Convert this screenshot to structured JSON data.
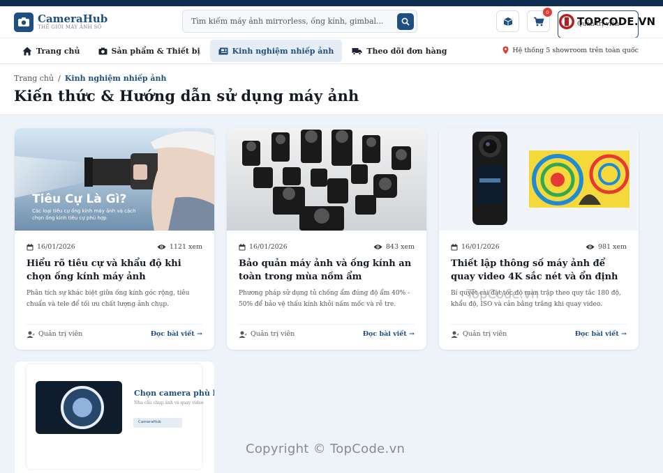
{
  "brand": {
    "name": "CameraHub",
    "tagline": "THẾ GIỚI MÁY ẢNH SỐ"
  },
  "search": {
    "placeholder": "Tìm kiếm máy ảnh mirrorless, ống kính, gimbal..."
  },
  "cart": {
    "count": "0"
  },
  "account": {
    "label": "Quản trị viên"
  },
  "watermark": {
    "logo_text": "TOPCODE.VN",
    "mid_text": "TopCode.vn",
    "copyright": "Copyright © TopCode.vn"
  },
  "nav": {
    "items": [
      {
        "label": "Trang chủ",
        "icon": "home-icon",
        "active": false
      },
      {
        "label": "Sản phẩm & Thiết bị",
        "icon": "camera-icon",
        "active": false
      },
      {
        "label": "Kinh nghiệm nhiếp ảnh",
        "icon": "newspaper-icon",
        "active": true
      },
      {
        "label": "Theo dõi đơn hàng",
        "icon": "truck-icon",
        "active": false
      }
    ],
    "showroom": "Hệ thống 5 showroom trên toàn quốc"
  },
  "breadcrumb": {
    "home": "Trang chủ",
    "separator": "/",
    "current": "Kinh nghiệm nhiếp ảnh"
  },
  "page_title": "Kiến thức & Hướng dẫn sử dụng máy ảnh",
  "articles": [
    {
      "date": "16/01/2026",
      "views": "1121 xem",
      "title": "Hiểu rõ tiêu cự và khẩu độ khi chọn ống kính máy ảnh",
      "desc": "Phân tích sự khác biệt giữa ống kính góc rộng, tiêu chuẩn và tele để tối ưu chất lượng ảnh chụp.",
      "author": "Quản trị viên",
      "read_more": "Đọc bài viết →",
      "image_heading": "Tiêu Cự Là Gì?",
      "image_caption": "Các loại tiêu cự ống kính máy ảnh và cách chọn ống kính tiêu cự phù hợp"
    },
    {
      "date": "16/01/2026",
      "views": "843 xem",
      "title": "Bảo quản máy ảnh và ống kính an toàn trong mùa nồm ẩm",
      "desc": "Phương pháp sử dụng tủ chống ẩm đúng độ ẩm 40% - 50% để bảo vệ thấu kính khỏi nấm mốc và rễ tre.",
      "author": "Quản trị viên",
      "read_more": "Đọc bài viết →"
    },
    {
      "date": "16/01/2026",
      "views": "981 xem",
      "title": "Thiết lập thông số máy ảnh để quay video 4K sắc nét và ổn định",
      "desc": "Bí quyết cài đặt tốc độ màn trập theo quy tắc 180 độ, khẩu độ, ISO và cân bằng trắng khi quay video.",
      "author": "Quản trị viên",
      "read_more": "Đọc bài viết →"
    }
  ],
  "article4": {
    "image_title": "Chọn camera phù h",
    "image_sub": "Nhu cầu chụp ảnh và quay video",
    "image_tag": "CameraHub"
  },
  "colors": {
    "primary": "#1d4f80",
    "topbar": "#0f2f52",
    "badge": "#e53935",
    "page_bg": "#eef3f9"
  }
}
